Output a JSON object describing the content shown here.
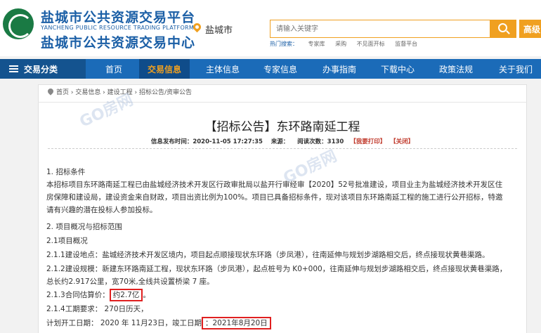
{
  "header": {
    "title_cn_1": "盐城市公共资源交易平台",
    "title_en": "YANCHENG PUBLIC RESOURCE TRADING PLATFORM",
    "title_cn_2": "盐城市公共资源交易中心",
    "location": "盐城市",
    "search_placeholder": "请输入关键字",
    "register_label": "高级",
    "hot_lead": "热门搜索：",
    "hot_terms": [
      "专家库",
      "采购",
      "不见面开标",
      "监督平台"
    ]
  },
  "nav": {
    "category": "交易分类",
    "items": [
      "首页",
      "交易信息",
      "主体信息",
      "专家信息",
      "办事指南",
      "下载中心",
      "政策法规",
      "关于我们"
    ],
    "active": "交易信息"
  },
  "breadcrumb": "首页 › 交易信息 › 建设工程 › 招标公告/资审公告",
  "article": {
    "title": "【招标公告】东环路南延工程",
    "meta_date": "信息发布时间：2020-11-05 17:27:35",
    "meta_source": "来源：",
    "meta_views": "阅读次数：3130",
    "print_label": "【我要打印】",
    "close_label": "【关闭】",
    "lines": [
      "1. 招标条件",
      "本招标项目东环路南延工程已由盐城经济技术开发区行政审批局以盐开行审经审【2020】52号批准建设，项目业主为盐城经济技术开发区住",
      "房保障和建设局，建设资金来自财政，项目出资比例为100%。项目已具备招标条件，现对该项目东环路南延工程的施工进行公开招标，特邀",
      "请有兴趣的潜在投标人参加投标。",
      "2. 项目概况与招标范围",
      "2.1项目概况",
      "2.1.1建设地点：盐城经济技术开发区境内，项目起点顺接现状东环路（步凤港），往南延伸与规划步湖路相交后，终点接现状黄巷渠路。",
      "2.1.2建设规模：新建东环路南延工程，现状东环路（步凤港），起点桩号为 K0+000，往南延伸与规划步湖路相交后，终点接现状黄巷渠路，",
      "总长约2.917公里，宽70米,全线共设置桥梁 7 座。"
    ],
    "price_label": "2.1.3合同估算价：",
    "price_value": "约2.7亿",
    "price_suffix": "。",
    "duration": "2.1.4工期要求： 270日历天，",
    "schedule_label": "计划开工日期： 2020 年 11月23日，竣工日期",
    "schedule_value": "：2021年8月20日"
  },
  "watermark": "GO房网",
  "colors": {
    "brand_blue": "#1b6bb8",
    "accent_orange": "#f0a020",
    "highlight_red": "#e02020"
  }
}
